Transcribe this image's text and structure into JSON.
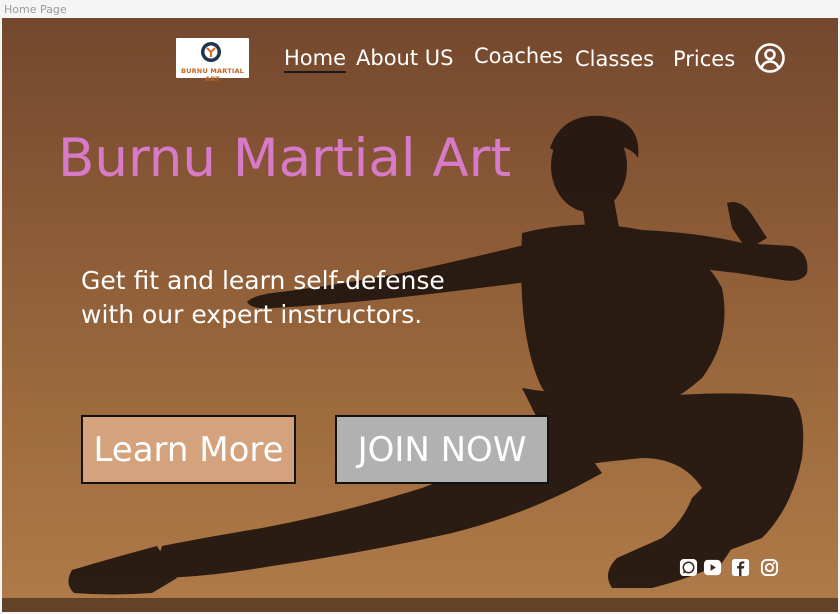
{
  "frame": {
    "label": "Home Page"
  },
  "brand": {
    "logo_text": "BURNU MARTIAL ART"
  },
  "nav": {
    "items": [
      {
        "label": "Home",
        "active": true
      },
      {
        "label": "About US",
        "active": false
      },
      {
        "label": "Coaches",
        "active": false
      },
      {
        "label": "Classes",
        "active": false
      },
      {
        "label": "Prices",
        "active": false
      }
    ],
    "user_icon": "user-circle-icon"
  },
  "hero": {
    "title": "Burnu Martial Art",
    "tagline_line1": "Get fit and learn self-defense",
    "tagline_line2": "with our expert instructors."
  },
  "buttons": {
    "learn_more": "Learn More",
    "join_now": "JOIN NOW"
  },
  "social": [
    "whatsapp-icon",
    "youtube-icon",
    "facebook-icon",
    "instagram-icon"
  ],
  "colors": {
    "title": "#d77bc8",
    "learn_more_bg": "#d4a27c",
    "join_now_bg": "#b1b1b1",
    "hero_top": "#74482e",
    "hero_bottom": "#b07b49"
  }
}
